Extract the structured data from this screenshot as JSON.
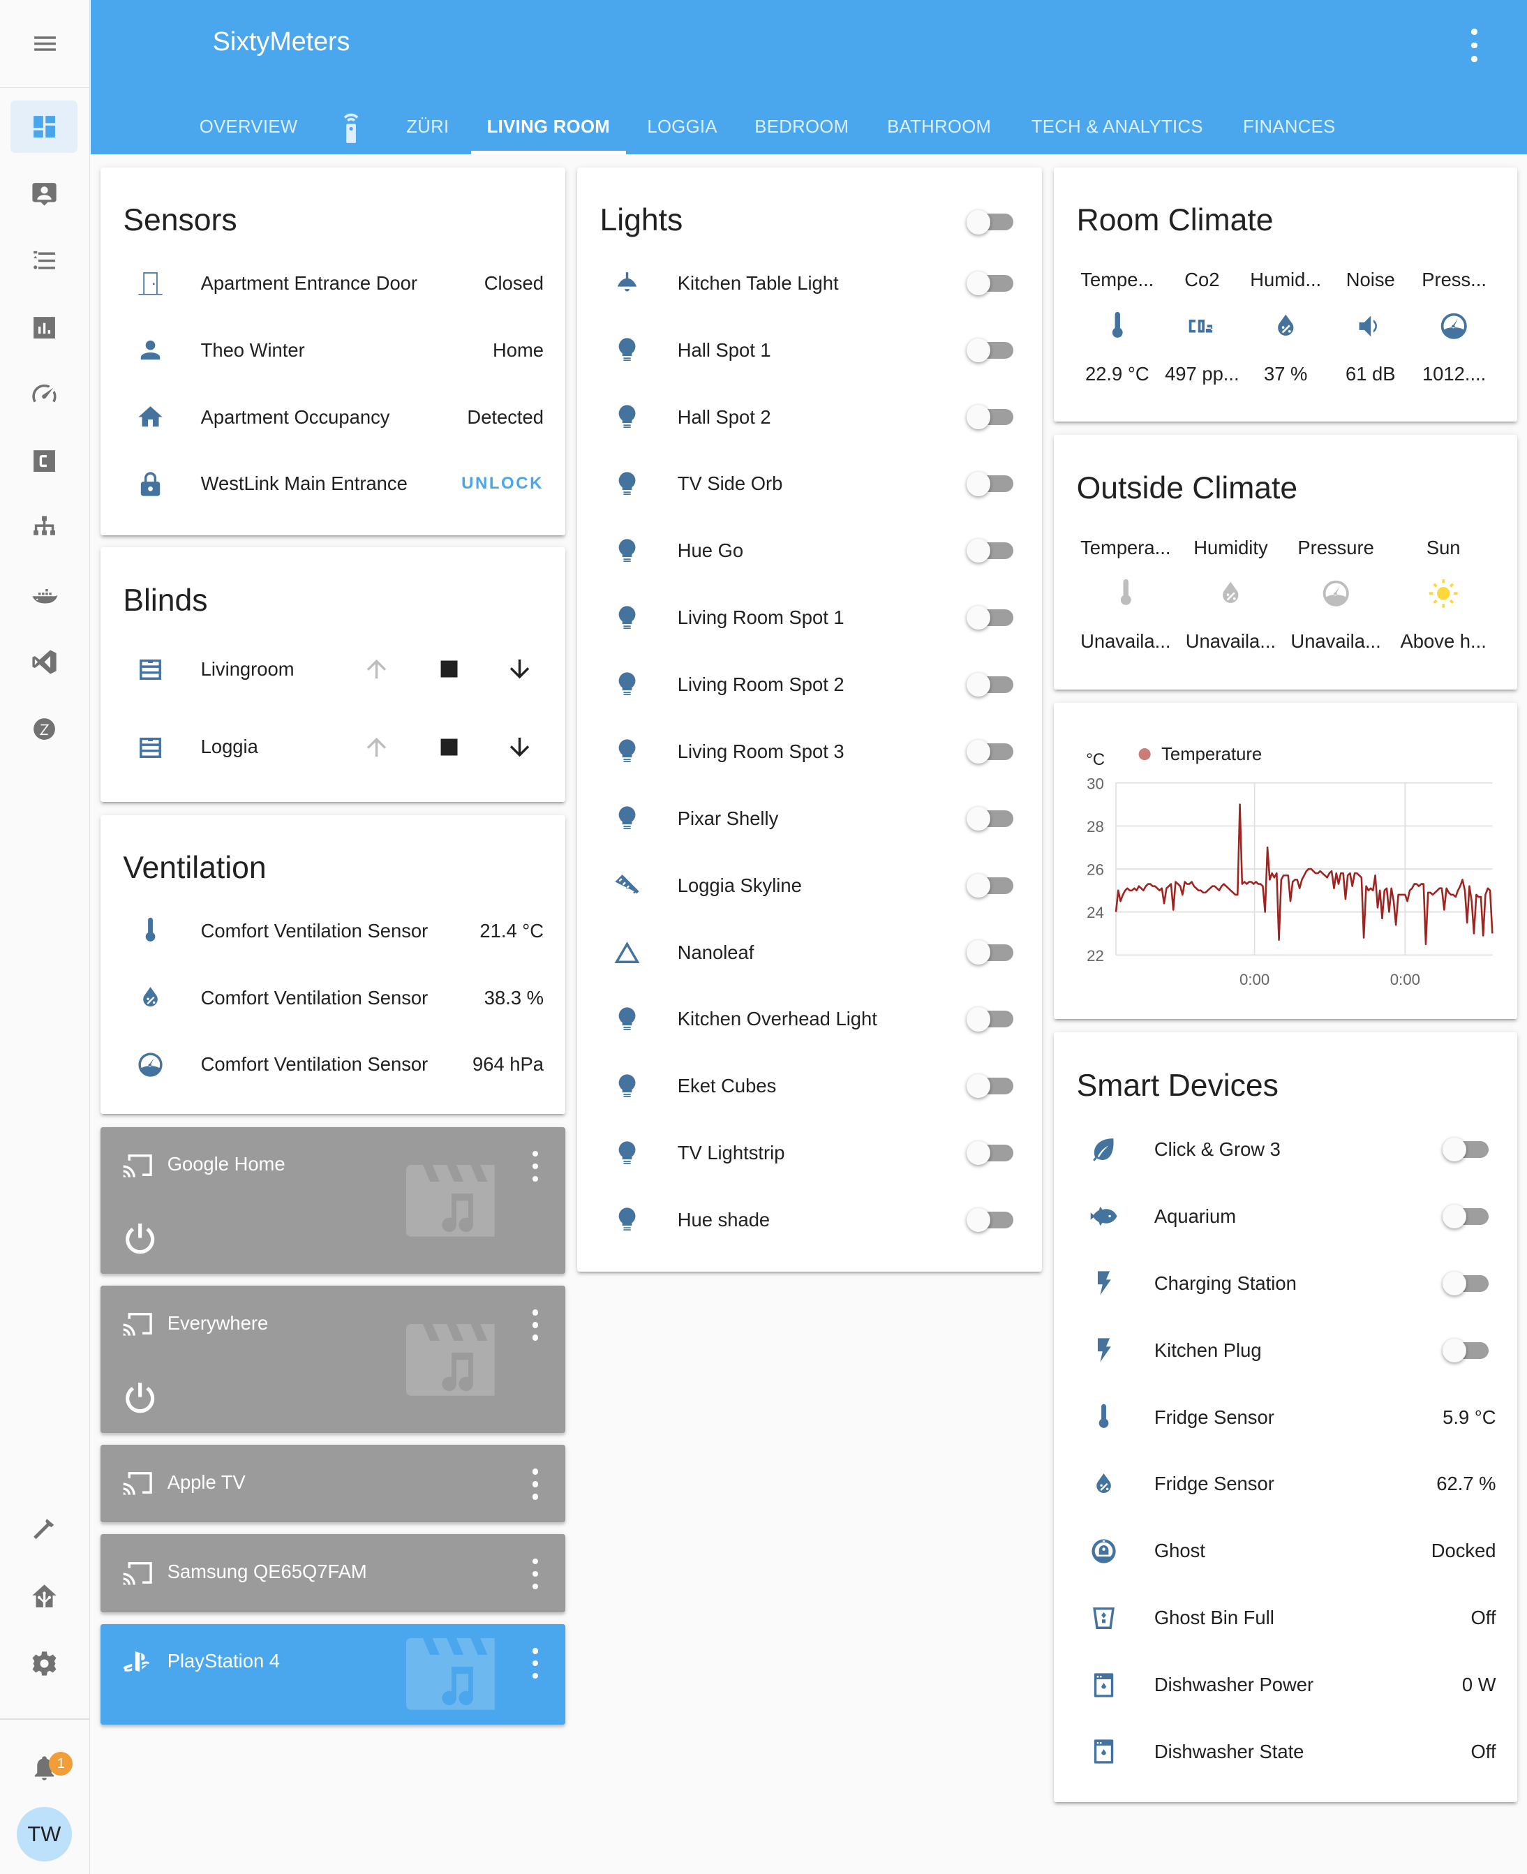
{
  "app": {
    "title": "SixtyMeters"
  },
  "colors": {
    "primary": "#4aa7ed",
    "icon": "#44739e",
    "accent": "#49a6ed",
    "chart_line": "#9e2420",
    "badge": "#f19d38"
  },
  "sidebar": {
    "items": [
      {
        "icon": "dashboard-icon",
        "active": true
      },
      {
        "icon": "account-box-icon"
      },
      {
        "icon": "format-list-icon"
      },
      {
        "icon": "chart-bar-icon"
      },
      {
        "icon": "speedometer-icon"
      },
      {
        "icon": "alpha-c-box-icon"
      },
      {
        "icon": "network-icon"
      },
      {
        "icon": "docker-icon"
      },
      {
        "icon": "vscode-icon"
      },
      {
        "icon": "zwave-icon"
      }
    ],
    "bottom_items": [
      {
        "icon": "hammer-icon"
      },
      {
        "icon": "home-assistant-icon"
      },
      {
        "icon": "settings-icon"
      }
    ],
    "notifications_count": "1",
    "user_initials": "TW"
  },
  "tabs": [
    {
      "label": "OVERVIEW"
    },
    {
      "label": "",
      "icon": "remote-icon"
    },
    {
      "label": "ZÜRI"
    },
    {
      "label": "LIVING ROOM",
      "active": true
    },
    {
      "label": "LOGGIA"
    },
    {
      "label": "BEDROOM"
    },
    {
      "label": "BATHROOM"
    },
    {
      "label": "TECH & ANALYTICS"
    },
    {
      "label": "FINANCES"
    }
  ],
  "sensors": {
    "title": "Sensors",
    "rows": [
      {
        "name": "Apartment Entrance Door",
        "value": "Closed",
        "icon": "door-icon"
      },
      {
        "name": "Theo Winter",
        "value": "Home",
        "icon": "account-icon"
      },
      {
        "name": "Apartment Occupancy",
        "value": "Detected",
        "icon": "home-icon"
      },
      {
        "name": "WestLink Main Entrance",
        "action": "UNLOCK",
        "icon": "lock-icon"
      }
    ]
  },
  "blinds": {
    "title": "Blinds",
    "rows": [
      {
        "name": "Livingroom",
        "icon": "window-shutter-icon"
      },
      {
        "name": "Loggia",
        "icon": "window-shutter-icon"
      }
    ]
  },
  "ventilation": {
    "title": "Ventilation",
    "rows": [
      {
        "name": "Comfort Ventilation Sensor",
        "value": "21.4 °C",
        "icon": "thermometer-icon"
      },
      {
        "name": "Comfort Ventilation Sensor",
        "value": "38.3 %",
        "icon": "water-percent-icon"
      },
      {
        "name": "Comfort Ventilation Sensor",
        "value": "964 hPa",
        "icon": "gauge-icon"
      }
    ]
  },
  "media_players": [
    {
      "name": "Google Home",
      "state": "off"
    },
    {
      "name": "Everywhere",
      "state": "off"
    },
    {
      "name": "Apple TV",
      "state": "off"
    },
    {
      "name": "Samsung QE65Q7FAM",
      "state": "off"
    },
    {
      "name": "PlayStation 4",
      "state": "on"
    }
  ],
  "lights": {
    "title": "Lights",
    "master_on": false,
    "rows": [
      {
        "name": "Kitchen Table Light",
        "icon": "ceiling-light-icon",
        "on": false
      },
      {
        "name": "Hall Spot 1",
        "icon": "lightbulb-icon",
        "on": false
      },
      {
        "name": "Hall Spot 2",
        "icon": "lightbulb-icon",
        "on": false
      },
      {
        "name": "TV Side Orb",
        "icon": "lightbulb-icon",
        "on": false
      },
      {
        "name": "Hue Go",
        "icon": "lightbulb-icon",
        "on": false
      },
      {
        "name": "Living Room Spot 1",
        "icon": "lightbulb-icon",
        "on": false
      },
      {
        "name": "Living Room Spot 2",
        "icon": "lightbulb-icon",
        "on": false
      },
      {
        "name": "Living Room Spot 3",
        "icon": "lightbulb-icon",
        "on": false
      },
      {
        "name": "Pixar Shelly",
        "icon": "lightbulb-icon",
        "on": false
      },
      {
        "name": "Loggia Skyline",
        "icon": "led-strip-icon",
        "on": false
      },
      {
        "name": "Nanoleaf",
        "icon": "triangle-outline-icon",
        "on": false
      },
      {
        "name": "Kitchen Overhead Light",
        "icon": "lightbulb-icon",
        "on": false
      },
      {
        "name": "Eket Cubes",
        "icon": "lightbulb-icon",
        "on": false
      },
      {
        "name": "TV Lightstrip",
        "icon": "lightbulb-icon",
        "on": false
      },
      {
        "name": "Hue shade",
        "icon": "lightbulb-icon",
        "on": false
      }
    ]
  },
  "room_climate": {
    "title": "Room Climate",
    "items": [
      {
        "label": "Tempe...",
        "value": "22.9 °C",
        "icon": "thermometer-icon"
      },
      {
        "label": "Co2",
        "value": "497 pp...",
        "icon": "co2-icon"
      },
      {
        "label": "Humid...",
        "value": "37 %",
        "icon": "water-percent-icon"
      },
      {
        "label": "Noise",
        "value": "61 dB",
        "icon": "volume-icon"
      },
      {
        "label": "Press...",
        "value": "1012....",
        "icon": "gauge-icon"
      }
    ]
  },
  "outside_climate": {
    "title": "Outside Climate",
    "items": [
      {
        "label": "Tempera...",
        "value": "Unavaila...",
        "icon": "thermometer-icon",
        "available": false
      },
      {
        "label": "Humidity",
        "value": "Unavaila...",
        "icon": "water-percent-icon",
        "available": false
      },
      {
        "label": "Pressure",
        "value": "Unavaila...",
        "icon": "gauge-icon",
        "available": false
      },
      {
        "label": "Sun",
        "value": "Above h...",
        "icon": "sun-icon",
        "available": true
      }
    ]
  },
  "chart_data": {
    "type": "line",
    "title": "",
    "ylabel": "°C",
    "xlabel": "",
    "ylim": [
      22,
      30
    ],
    "yticks": [
      "30",
      "28",
      "26",
      "24",
      "22"
    ],
    "xticks": [
      "0:00",
      "0:00"
    ],
    "grid": true,
    "legend": "top-left",
    "series": [
      {
        "name": "Temperature",
        "color": "#9e2420",
        "values": [
          24.0,
          25.0,
          24.5,
          24.8,
          25.0,
          25.1,
          25.0,
          25.0,
          25.1,
          25.0,
          25.2,
          25.1,
          25.0,
          25.2,
          25.3,
          25.3,
          25.2,
          25.2,
          25.1,
          25.0,
          25.1,
          24.4,
          25.1,
          25.2,
          25.3,
          24.1,
          25.4,
          25.3,
          25.2,
          24.8,
          25.4,
          25.3,
          25.3,
          25.4,
          25.2,
          25.1,
          25.0,
          25.0,
          24.9,
          24.9,
          25.0,
          25.1,
          25.2,
          25.2,
          25.1,
          25.0,
          25.2,
          25.3,
          25.2,
          25.1,
          25.0,
          24.9,
          24.8,
          24.8,
          29.0,
          25.3,
          25.4,
          25.3,
          25.4,
          25.4,
          25.3,
          25.4,
          25.3,
          25.3,
          25.2,
          24.0,
          27.0,
          25.5,
          25.8,
          25.6,
          25.8,
          22.7,
          25.5,
          25.7,
          25.7,
          25.7,
          24.5,
          25.4,
          25.5,
          25.5,
          25.1,
          25.5,
          25.7,
          25.9,
          26.0,
          26.0,
          25.9,
          25.8,
          25.8,
          25.9,
          25.8,
          25.7,
          25.6,
          25.8,
          25.9,
          25.1,
          25.8,
          25.3,
          25.8,
          25.8,
          24.6,
          25.7,
          25.8,
          25.2,
          25.8,
          25.8,
          25.7,
          25.6,
          22.8,
          25.2,
          25.0,
          25.1,
          25.0,
          25.7,
          24.2,
          25.0,
          23.7,
          25.0,
          25.1,
          24.0,
          25.1,
          24.5,
          23.4,
          24.8,
          24.8,
          24.8,
          24.8,
          24.5,
          25.0,
          25.1,
          25.3,
          25.3,
          25.2,
          25.3,
          25.3,
          22.5,
          24.9,
          24.9,
          24.8,
          24.9,
          25.0,
          25.1,
          25.1,
          24.1,
          25.1,
          24.9,
          24.8,
          24.8,
          24.7,
          25.0,
          25.2,
          25.5,
          25.0,
          23.5,
          25.2,
          24.5,
          23.0,
          24.8,
          24.7,
          24.7,
          22.9,
          24.8,
          25.1,
          25.0,
          23.0
        ]
      }
    ]
  },
  "smart_devices": {
    "title": "Smart Devices",
    "rows": [
      {
        "name": "Click & Grow 3",
        "icon": "leaf-icon",
        "toggle": true,
        "on": false
      },
      {
        "name": "Aquarium",
        "icon": "fish-icon",
        "toggle": true,
        "on": false
      },
      {
        "name": "Charging Station",
        "icon": "flash-icon",
        "toggle": true,
        "on": false
      },
      {
        "name": "Kitchen Plug",
        "icon": "flash-icon",
        "toggle": true,
        "on": false
      },
      {
        "name": "Fridge Sensor",
        "icon": "thermometer-icon",
        "value": "5.9 °C"
      },
      {
        "name": "Fridge Sensor",
        "icon": "water-percent-icon",
        "value": "62.7 %"
      },
      {
        "name": "Ghost",
        "icon": "robot-vacuum-icon",
        "value": "Docked"
      },
      {
        "name": "Ghost Bin Full",
        "icon": "delete-variant-icon",
        "value": "Off"
      },
      {
        "name": "Dishwasher Power",
        "icon": "dishwasher-icon",
        "value": "0 W"
      },
      {
        "name": "Dishwasher State",
        "icon": "dishwasher-icon",
        "value": "Off"
      }
    ]
  }
}
